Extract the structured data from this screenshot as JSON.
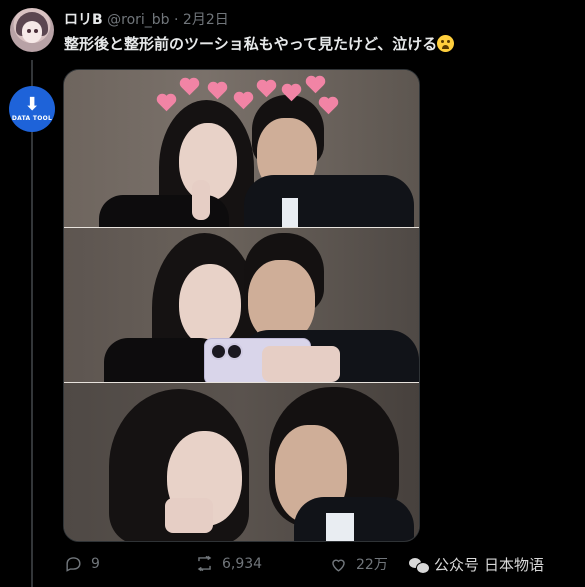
{
  "tweet": {
    "display_name": "ロリB",
    "handle": "@rori_bb",
    "separator": "·",
    "date": "2月2日",
    "text": "整形後と整形前のツーショ私もやって見たけど、泣ける",
    "emoji": "loudly-crying-face"
  },
  "side_badge": {
    "label": "DATA TOOL",
    "icon": "download-icon",
    "color": "#1e63d9"
  },
  "actions": {
    "replies": "9",
    "retweets": "6,934",
    "likes": "22万"
  },
  "watermark": {
    "brand": "公众号",
    "account": "日本物语"
  },
  "colors": {
    "background": "#000000",
    "text_primary": "#e7e9ea",
    "text_secondary": "#71767b",
    "thread_line": "#333639",
    "heart_sticker": "#f184a5"
  }
}
